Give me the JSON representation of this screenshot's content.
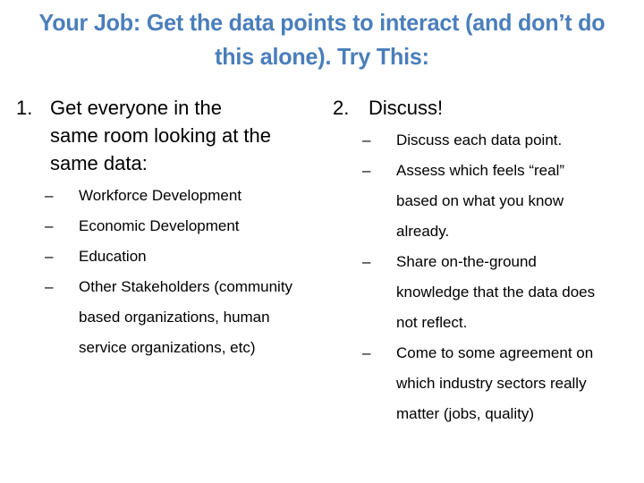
{
  "slide": {
    "title": "Your Job: Get the data points to interact (and don’t do this alone). Try This:",
    "title_color": "#4a7ebb",
    "background_color": "#ffffff",
    "body_text_color": "#000000",
    "dash_marker": "–"
  },
  "columns": {
    "left": {
      "number": "1.",
      "heading": "Get everyone in the same room looking at the same data:",
      "bullets": [
        "Workforce Development",
        "Economic Development",
        "Education",
        "Other Stakeholders (community based organizations, human service organizations, etc)"
      ]
    },
    "right": {
      "number": "2.",
      "heading": "Discuss!",
      "bullets": [
        "Discuss each data point.",
        "Assess which feels “real” based on what you know already.",
        "Share on-the-ground knowledge that the data does not reflect.",
        "Come to some agreement on which industry sectors really matter (jobs, quality)"
      ]
    }
  }
}
